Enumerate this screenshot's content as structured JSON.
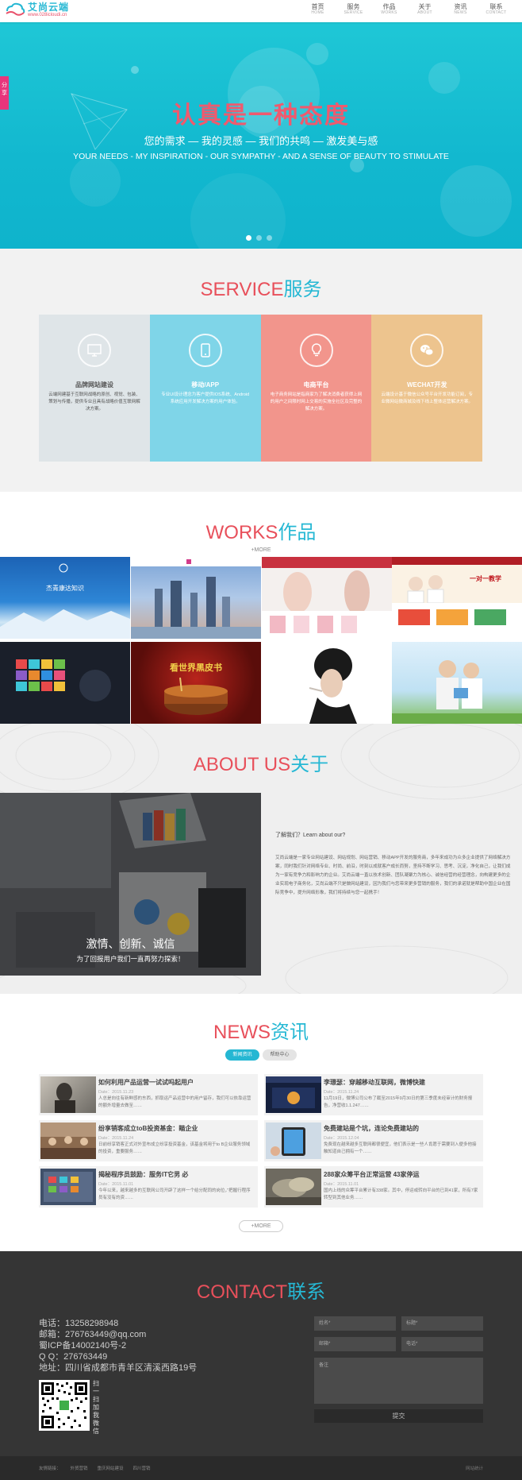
{
  "header": {
    "logo_name": "艾尚云端",
    "logo_url": "www.028icloudi.cn",
    "nav": [
      {
        "cn": "首页",
        "en": "HOME"
      },
      {
        "cn": "服务",
        "en": "SERVICE"
      },
      {
        "cn": "作品",
        "en": "WORKS"
      },
      {
        "cn": "关于",
        "en": "ABOUT"
      },
      {
        "cn": "资讯",
        "en": "NEWS"
      },
      {
        "cn": "联系",
        "en": "CONTACT"
      }
    ]
  },
  "share_tab": "分享",
  "hero": {
    "title": "认真是一种态度",
    "sub_cn": "您的需求 — 我的灵感 — 我们的共鸣 — 激发美与感",
    "sub_en": "YOUR NEEDS - MY INSPIRATION - OUR SYMPATHY - AND A SENSE OF BEAUTY TO STIMULATE",
    "slide_count": 3,
    "active_slide": 1
  },
  "service": {
    "title_en": "SERVICE",
    "title_cn": "服务",
    "cards": [
      {
        "name": "品牌网站建设",
        "icon": "monitor-icon",
        "bg": "#dfe5e8",
        "text": "#555555",
        "desc": "云端网建基于互联网战略的原创、视觉、包装、策划与传播，提供专业且具有战略价值互联网解决方案。"
      },
      {
        "name": "移动/APP",
        "icon": "phone-icon",
        "bg": "#7fd5e8",
        "text": "#ffffff",
        "desc": "专业UI设计理念为客户提供IOS系统、Android系统应用开发解决方案的用户体验。"
      },
      {
        "name": "电商平台",
        "icon": "lightbulb-icon",
        "bg": "#f2958c",
        "text": "#ffffff",
        "desc": "电子商务网站是指商家为了解决消费者获得上网的用户之间限时网上交易的实施全社区及完整的解决方案。"
      },
      {
        "name": "WECHAT开发",
        "icon": "wechat-icon",
        "bg": "#edc48e",
        "text": "#ffffff",
        "desc": "云端设计基于微信公众号平台开发功能订阅，专业微网站微商城及线下线上整体运营解决方案。"
      }
    ]
  },
  "works": {
    "title_en": "WORKS",
    "title_cn": "作品",
    "more": "+MORE",
    "thumb_texts": [
      "杰青康达知识",
      "一对一教学",
      "看世界黑皮书"
    ]
  },
  "about": {
    "title_en": "ABOUT US",
    "title_cn": "关于",
    "slogan": "激情、创新、诚信",
    "slogan2": "为了回报用户我们一直再努力探索！",
    "question": "了解我们？Learn about our?",
    "body": "艾尚云端是一家专业网站建设、网站规划、网站营销、移动APP开发的服务商，多年来成功为众多企业提供了网络解决方案，同时我们针对网络专业、时尚、前沿，时刻以成就客户成长而努，坚持不断学习、思考、沉淀，净化自己，让我们成为一家有竞争力和影响力的企业。艾尚云端一直以技术创新、团队凝聚力为核心、诚信经营的经营理念，向构建更多的企业实现电子商务化，艾尚云端不只是做网站建设，因为我们与您带来更多营销的服务，我们的承诺就是帮助中国企业在国际竞争中，提升网络形象，我们将持续与您一起携手！"
  },
  "news": {
    "title_en": "NEWS",
    "title_cn": "资讯",
    "tabs": [
      "新闻资讯",
      "帮助中心"
    ],
    "more": "+MORE",
    "items": [
      {
        "title": "如何利用产品运营一试试吗起用户",
        "date": "Date：2015.11.23",
        "summary": "人总是向往有新鲜感的东西，抓取运产品运营中的用户留存，我们可以依靠运营的额外增量去做至……"
      },
      {
        "title": "李璟瑟：穿越移动互联网，微博快建",
        "date": "Date：2015.11.24",
        "summary": "11月19日，微博公司公布了截至2015年9月30日的第三季度未经审计的财务报告，净营收1.1.247……"
      },
      {
        "title": "纷享销客成立toB投资基金：瞄企业",
        "date": "Date：2015.11.24",
        "summary": "日前纷享销客正式对外宣布成立纷享投资基金，该基金将用于to B企业服务领域的投资，重要服务……"
      },
      {
        "title": "免费建站是个坑，连论免费建站的",
        "date": "Date：2015.12.04",
        "summary": "免费现在越来越多互联网都很便宜，他们表示是一些人肯愿于需要到入便多他接触知道自己拥有一个……"
      },
      {
        "title": "揭秘程序员鼓励：服务IT它男 必",
        "date": "Date：2015.11.01",
        "summary": "今年以来，越来越多的互联网公司开辟了这样一个给分配同的岗位，”把握行程序员有没有的资……"
      },
      {
        "title": "288家众筹平台正常运营 43家停运",
        "date": "Date：2015.11.01",
        "summary": "国内上线的众筹平台累计有338家。其中，停运或转向平台的已到41家，所有7家转型到其他业务……"
      }
    ]
  },
  "contact": {
    "title_en": "CONTACT",
    "title_cn": "联系",
    "lines": [
      "电话：13258298948",
      "邮箱：276763449@qq.com",
      "蜀ICP备14002140号-2",
      "Q  Q：276763449",
      "地址：四川省成都市青羊区清溪西路19号"
    ],
    "qr_caption": "扫一扫加我微信",
    "form": {
      "name": "姓名*",
      "title": "标题*",
      "email": "邮箱*",
      "phone": "电话*",
      "remark": "备注",
      "submit": "提交"
    }
  },
  "footer": {
    "links": [
      "友情链接：",
      "外贸营销",
      "重庆网站建设",
      "四川营销"
    ],
    "right": "网站统计"
  },
  "colors": {
    "accent_red": "#e8505b",
    "accent_cyan": "#26b8d4",
    "hero_bg": "#14bcd1",
    "contact_bg": "#353535"
  }
}
